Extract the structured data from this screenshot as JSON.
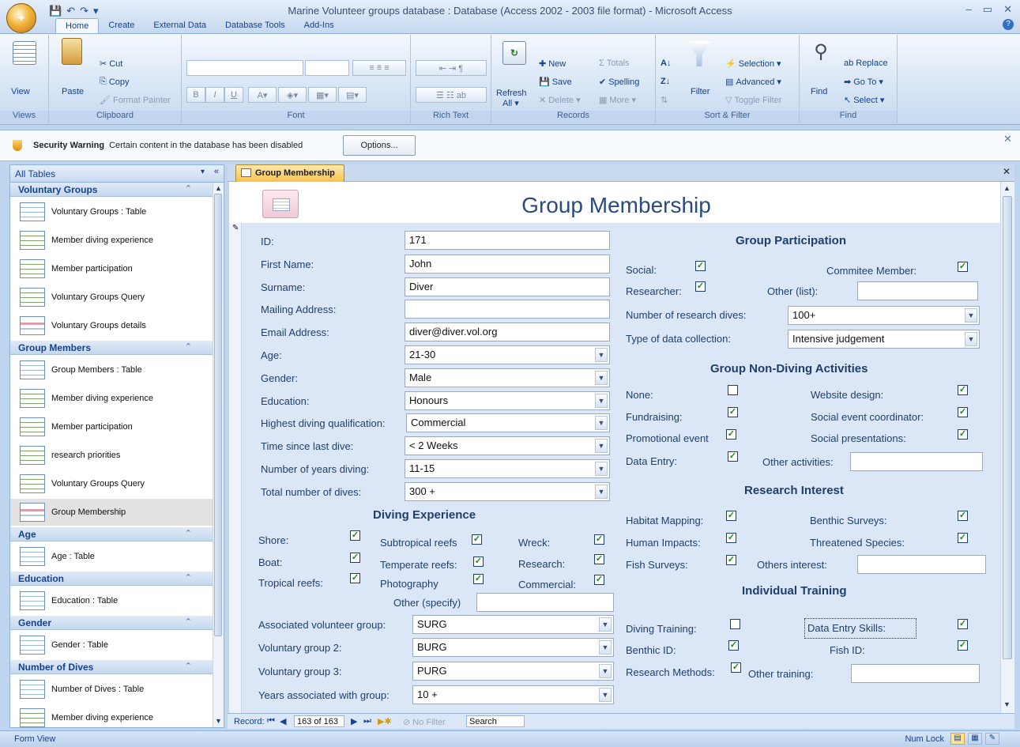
{
  "window": {
    "title": "Marine Volunteer groups database : Database (Access 2002 - 2003 file format) - Microsoft Access",
    "minimize": "–",
    "maximize": "▭",
    "close": "✕",
    "help": "?"
  },
  "quick_access": {
    "save": "💾",
    "undo": "↶",
    "redo": "↷",
    "customize": "▾"
  },
  "tabs": [
    "Home",
    "Create",
    "External Data",
    "Database Tools",
    "Add-Ins"
  ],
  "ribbon": {
    "views": {
      "view": "View",
      "label": "Views"
    },
    "clipboard": {
      "paste": "Paste",
      "cut": "Cut",
      "copy": "Copy",
      "format_painter": "Format Painter",
      "label": "Clipboard"
    },
    "font": {
      "label": "Font",
      "bold": "B",
      "italic": "I",
      "underline": "U"
    },
    "rich_text": {
      "label": "Rich Text"
    },
    "records": {
      "refresh": "Refresh",
      "refresh_sub": "All ▾",
      "new": "New",
      "save": "Save",
      "delete": "Delete ▾",
      "totals": "Totals",
      "spelling": "Spelling",
      "more": "More ▾",
      "label": "Records"
    },
    "sort_filter": {
      "filter": "Filter",
      "selection": "Selection ▾",
      "advanced": "Advanced ▾",
      "toggle_filter": "Toggle Filter",
      "label": "Sort & Filter"
    },
    "find": {
      "find": "Find",
      "replace": "Replace",
      "goto": "Go To ▾",
      "select": "Select ▾",
      "label": "Find"
    }
  },
  "security": {
    "title": "Security Warning",
    "message": "Certain content in the database has been disabled",
    "options": "Options..."
  },
  "nav": {
    "header": "All Tables",
    "sections": [
      {
        "title": "Voluntary Groups",
        "items": [
          {
            "label": "Voluntary Groups : Table",
            "kind": "tbl"
          },
          {
            "label": "Member diving experience",
            "kind": "qry"
          },
          {
            "label": "Member participation",
            "kind": "qry"
          },
          {
            "label": "Voluntary Groups Query",
            "kind": "qry"
          },
          {
            "label": "Voluntary Groups details",
            "kind": "frm"
          }
        ]
      },
      {
        "title": "Group Members",
        "items": [
          {
            "label": "Group Members : Table",
            "kind": "tbl"
          },
          {
            "label": "Member diving experience",
            "kind": "qry"
          },
          {
            "label": "Member participation",
            "kind": "qry"
          },
          {
            "label": "research priorities",
            "kind": "qry"
          },
          {
            "label": "Voluntary Groups Query",
            "kind": "qry"
          },
          {
            "label": "Group Membership",
            "kind": "frm"
          }
        ]
      },
      {
        "title": "Age",
        "items": [
          {
            "label": "Age : Table",
            "kind": "tbl"
          }
        ]
      },
      {
        "title": "Education",
        "items": [
          {
            "label": "Education : Table",
            "kind": "tbl"
          }
        ]
      },
      {
        "title": "Gender",
        "items": [
          {
            "label": "Gender : Table",
            "kind": "tbl"
          }
        ]
      },
      {
        "title": "Number of Dives",
        "items": [
          {
            "label": "Number of Dives : Table",
            "kind": "tbl"
          },
          {
            "label": "Member diving experience",
            "kind": "qry"
          }
        ]
      }
    ]
  },
  "doc_tab": "Group Membership",
  "form": {
    "title": "Group Membership",
    "fields": {
      "id": {
        "label": "ID:",
        "value": "171"
      },
      "first_name": {
        "label": "First Name:",
        "value": "John"
      },
      "surname": {
        "label": "Surname:",
        "value": "Diver"
      },
      "mailing": {
        "label": "Mailing Address:",
        "value": ""
      },
      "email": {
        "label": "Email Address:",
        "value": "diver@diver.vol.org"
      },
      "age": {
        "label": "Age:",
        "value": "21-30"
      },
      "gender": {
        "label": "Gender:",
        "value": "Male"
      },
      "education": {
        "label": "Education:",
        "value": "Honours"
      },
      "qualification": {
        "label": "Highest diving qualification:",
        "value": "Commercial"
      },
      "last_dive": {
        "label": "Time since last dive:",
        "value": "< 2 Weeks"
      },
      "years_diving": {
        "label": "Number of years diving:",
        "value": "11-15"
      },
      "total_dives": {
        "label": "Total number of dives:",
        "value": "300 +"
      }
    },
    "diving_experience": {
      "title": "Diving Experience",
      "shore": "Shore:",
      "boat": "Boat:",
      "tropical": "Tropical reefs:",
      "subtropical": "Subtropical reefs",
      "temperate": "Temperate reefs:",
      "photography": "Photography",
      "wreck": "Wreck:",
      "research": "Research:",
      "commercial": "Commercial:",
      "other": "Other (specify)"
    },
    "groups": {
      "assoc": {
        "label": "Associated volunteer group:",
        "value": "SURG"
      },
      "g2": {
        "label": "Voluntary group 2:",
        "value": "BURG"
      },
      "g3": {
        "label": "Voluntary group 3:",
        "value": "PURG"
      },
      "years": {
        "label": "Years associated with group:",
        "value": "10 +"
      }
    },
    "participation": {
      "title": "Group Participation",
      "social": "Social:",
      "committee": "Commitee Member:",
      "researcher": "Researcher:",
      "other": "Other (list):",
      "num_dives": {
        "label": "Number of research dives:",
        "value": "100+"
      },
      "data_type": {
        "label": "Type of data collection:",
        "value": "Intensive judgement"
      }
    },
    "non_diving": {
      "title": "Group Non-Diving Activities",
      "none": "None:",
      "website": "Website design:",
      "fundraising": "Fundraising:",
      "social_event": "Social event coordinator:",
      "promo": "Promotional event",
      "presentations": "Social presentations:",
      "data_entry": "Data Entry:",
      "other": "Other activities:"
    },
    "research": {
      "title": "Research Interest",
      "habitat": "Habitat Mapping:",
      "benthic": "Benthic Surveys:",
      "human": "Human Impacts:",
      "threatened": "Threatened Species:",
      "fish": "Fish Surveys:",
      "others": "Others interest:"
    },
    "training": {
      "title": "Individual Training",
      "diving": "Diving Training:",
      "data_entry": "Data Entry Skills:",
      "benthic": "Benthic ID:",
      "fish": "Fish ID:",
      "methods": "Research Methods:",
      "other": "Other training:"
    }
  },
  "record_nav": {
    "label": "Record:",
    "current": "163 of 163",
    "no_filter": "No Filter",
    "search": "Search"
  },
  "status": {
    "left": "Form View",
    "num_lock": "Num Lock"
  }
}
